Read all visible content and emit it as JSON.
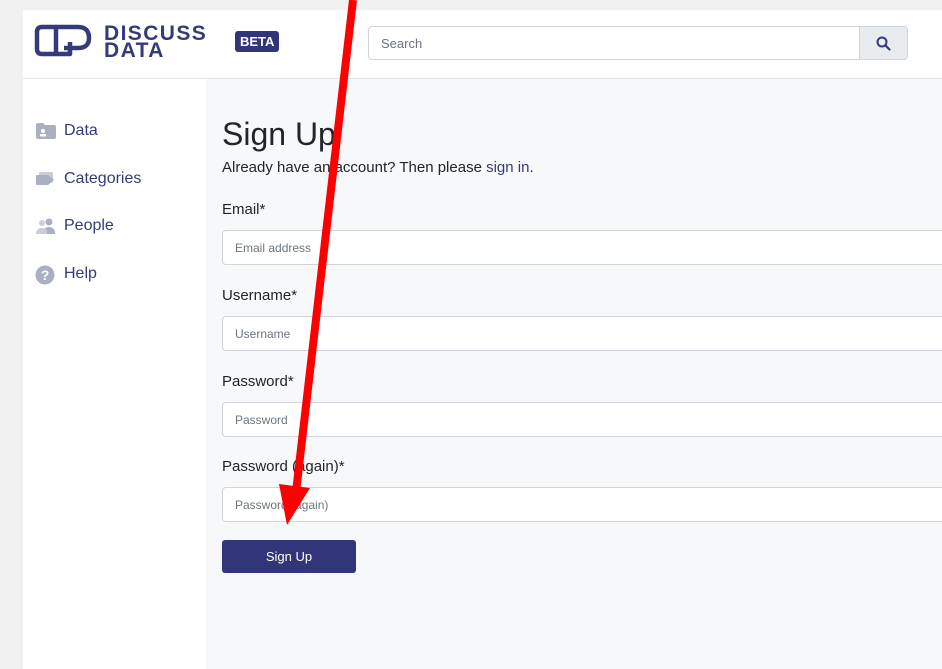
{
  "header": {
    "logo_line1": "DISCUSS",
    "logo_line2": "DATA",
    "beta_badge": "BETA",
    "search_placeholder": "Search"
  },
  "sidebar": {
    "items": [
      {
        "label": "Data",
        "icon": "folder-icon"
      },
      {
        "label": "Categories",
        "icon": "tag-icon"
      },
      {
        "label": "People",
        "icon": "people-icon"
      },
      {
        "label": "Help",
        "icon": "help-icon"
      }
    ]
  },
  "form": {
    "title": "Sign Up",
    "intro_text": "Already have an account? Then please ",
    "intro_link": "sign in",
    "intro_end": ".",
    "fields": [
      {
        "label": "Email*",
        "placeholder": "Email address"
      },
      {
        "label": "Username*",
        "placeholder": "Username"
      },
      {
        "label": "Password*",
        "placeholder": "Password"
      },
      {
        "label": "Password (again)*",
        "placeholder": "Password (again)"
      }
    ],
    "submit_label": "Sign Up"
  },
  "colors": {
    "brand": "#31367a",
    "link": "#353a78",
    "annotation_arrow": "#ff0000"
  }
}
